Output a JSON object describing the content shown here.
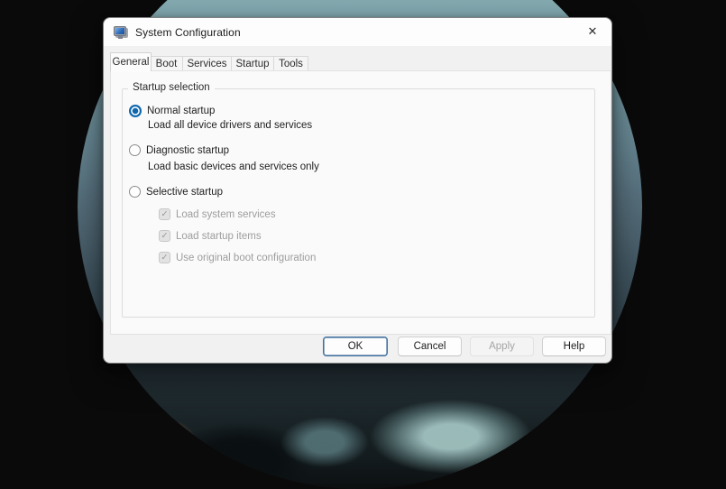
{
  "window": {
    "title": "System Configuration"
  },
  "icons": {
    "app_icon": "msconfig-monitor-icon",
    "close_glyph": "✕",
    "check_glyph": "✓"
  },
  "tabs": [
    {
      "label": "General",
      "active": true
    },
    {
      "label": "Boot",
      "active": false
    },
    {
      "label": "Services",
      "active": false
    },
    {
      "label": "Startup",
      "active": false
    },
    {
      "label": "Tools",
      "active": false
    }
  ],
  "general": {
    "group_title": "Startup selection",
    "radios": [
      {
        "label": "Normal startup",
        "description": "Load all device drivers and services",
        "selected": true
      },
      {
        "label": "Diagnostic startup",
        "description": "Load basic devices and services only",
        "selected": false
      },
      {
        "label": "Selective startup",
        "description": "",
        "selected": false
      }
    ],
    "checkboxes": [
      {
        "label": "Load system services",
        "checked": true,
        "disabled": true
      },
      {
        "label": "Load startup items",
        "checked": true,
        "disabled": true
      },
      {
        "label": "Use original boot configuration",
        "checked": true,
        "disabled": true
      }
    ]
  },
  "footer_buttons": [
    {
      "label": "OK",
      "default": true,
      "enabled": true
    },
    {
      "label": "Cancel",
      "default": false,
      "enabled": true
    },
    {
      "label": "Apply",
      "default": false,
      "enabled": false
    },
    {
      "label": "Help",
      "default": false,
      "enabled": true
    }
  ],
  "colors": {
    "accent_blue": "#0e67ae",
    "ok_button_border": "#42719f",
    "disabled_text": "#9d9d9d",
    "dialog_face": "#f1f1f1"
  }
}
